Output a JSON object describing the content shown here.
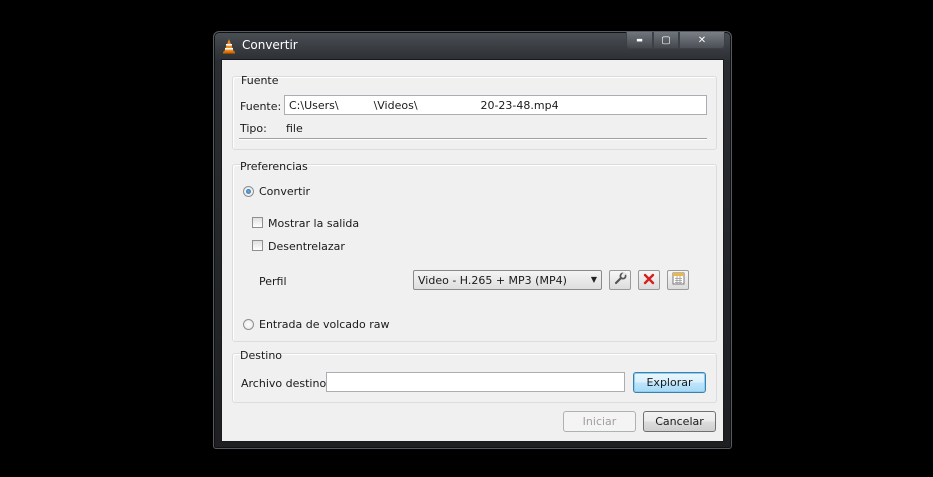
{
  "window": {
    "title": "Convertir",
    "caption_buttons": {
      "minimize": "▬",
      "maximize": "▢",
      "close": "✕"
    }
  },
  "source": {
    "group_title": "Fuente",
    "file_label": "Fuente:",
    "file_value": "C:\\Users\\          \\Videos\\                  20-23-48.mp4",
    "type_label": "Tipo:",
    "type_value": "file"
  },
  "preferences": {
    "group_title": "Preferencias",
    "convert_label": "Convertir",
    "convert_selected": true,
    "show_output_label": "Mostrar la salida",
    "show_output_checked": false,
    "deinterlace_label": "Desentrelazar",
    "deinterlace_checked": false,
    "profile_label": "Perfil",
    "profile_selected": "Video - H.265 + MP3 (MP4)",
    "profile_tools": [
      "wrench-icon",
      "delete-icon",
      "new-profile-icon"
    ],
    "raw_dump_label": "Entrada de volcado raw",
    "raw_dump_selected": false
  },
  "destination": {
    "group_title": "Destino",
    "file_label": "Archivo destino:",
    "file_value": "",
    "browse_label": "Explorar"
  },
  "footer": {
    "start_label": "Iniciar",
    "cancel_label": "Cancelar"
  },
  "colors": {
    "accent": "#3c7fb1",
    "delete_red": "#d42020",
    "vlc_orange": "#f08a1c"
  }
}
